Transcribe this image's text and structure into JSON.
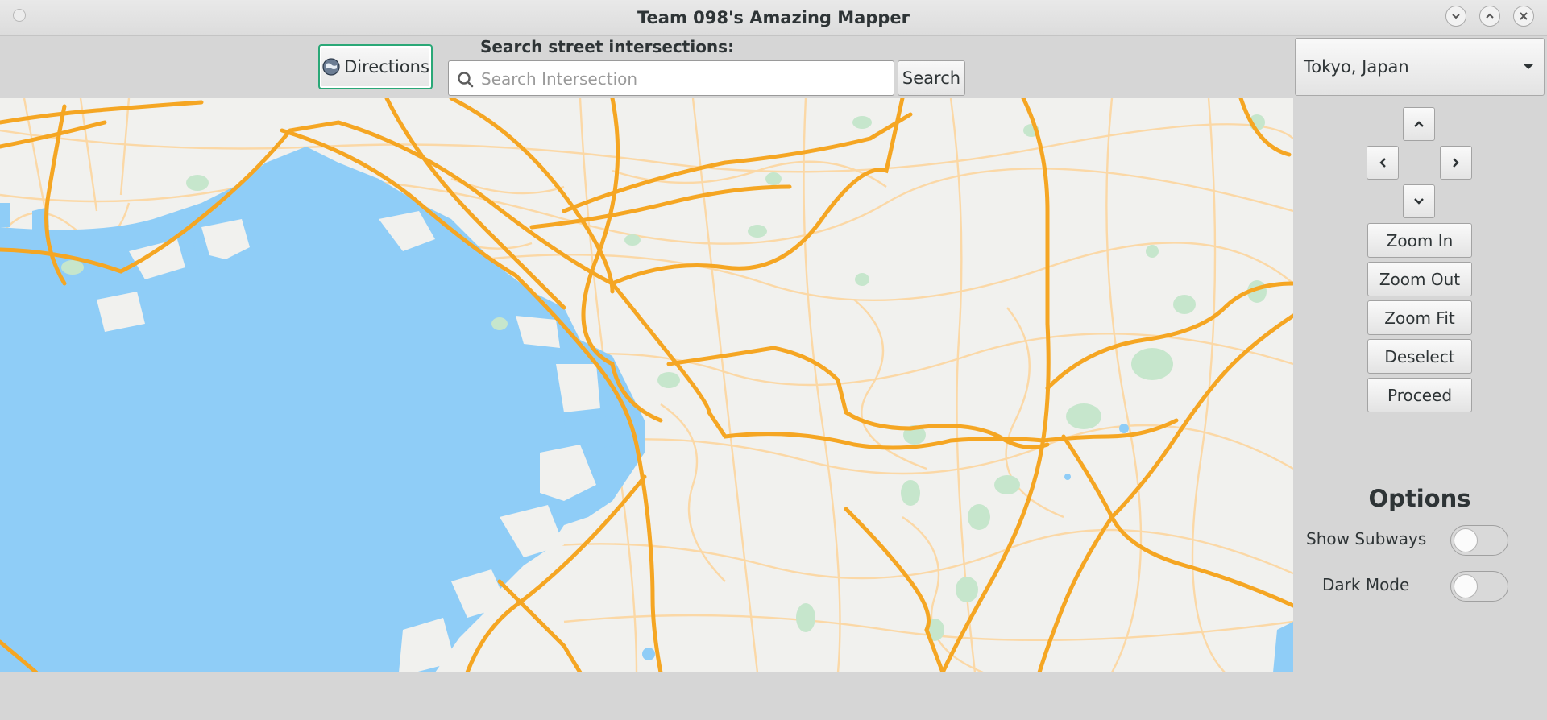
{
  "window": {
    "title": "Team 098's Amazing Mapper"
  },
  "toolbar": {
    "directions_label": "Directions",
    "search_label": "Search street intersections:",
    "search_placeholder": "Search Intersection",
    "search_value": "",
    "search_button": "Search"
  },
  "side_panel": {
    "city_selected": "Tokyo, Japan",
    "buttons": {
      "zoom_in": "Zoom In",
      "zoom_out": "Zoom Out",
      "zoom_fit": "Zoom Fit",
      "deselect": "Deselect",
      "proceed": "Proceed"
    },
    "options_title": "Options",
    "options": {
      "show_subways": {
        "label": "Show Subways",
        "on": false
      },
      "dark_mode": {
        "label": "Dark Mode",
        "on": false
      }
    }
  },
  "map": {
    "colors": {
      "land": "#f1f1ee",
      "water": "#8fcdf7",
      "park": "#c6e6cc",
      "major_road": "#f5a623",
      "minor_road": "#fbd8a6"
    }
  },
  "icons": {
    "directions": "globe-icon",
    "search": "magnifier-icon",
    "dropdown": "caret-down-icon",
    "pan_up": "chevron-up-icon",
    "pan_down": "chevron-down-icon",
    "pan_left": "chevron-left-icon",
    "pan_right": "chevron-right-icon"
  }
}
